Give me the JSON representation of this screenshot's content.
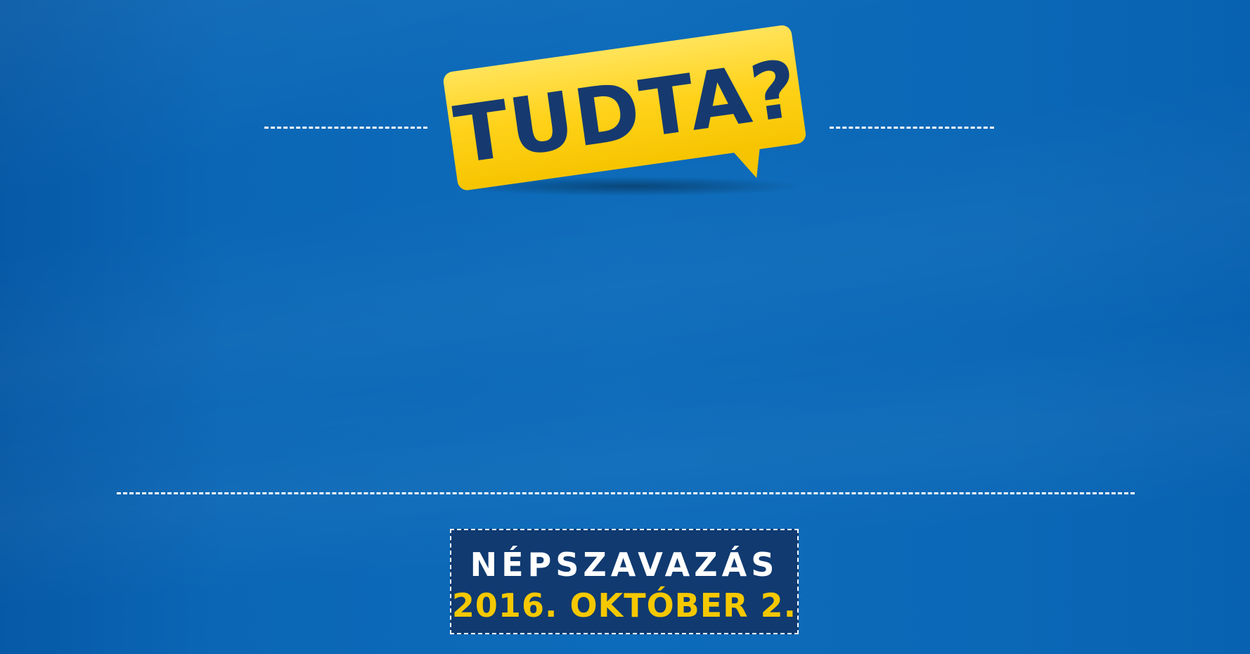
{
  "bubble": {
    "text": "TUDTA?"
  },
  "referendum": {
    "title": "NÉPSZAVAZÁS",
    "date": "2016. OKTÓBER 2."
  },
  "colors": {
    "background": "#0b67b6",
    "bubble_yellow": "#ffd21a",
    "text_navy": "#163a70",
    "date_yellow": "#f5c800",
    "dash_white": "#ffffff"
  }
}
